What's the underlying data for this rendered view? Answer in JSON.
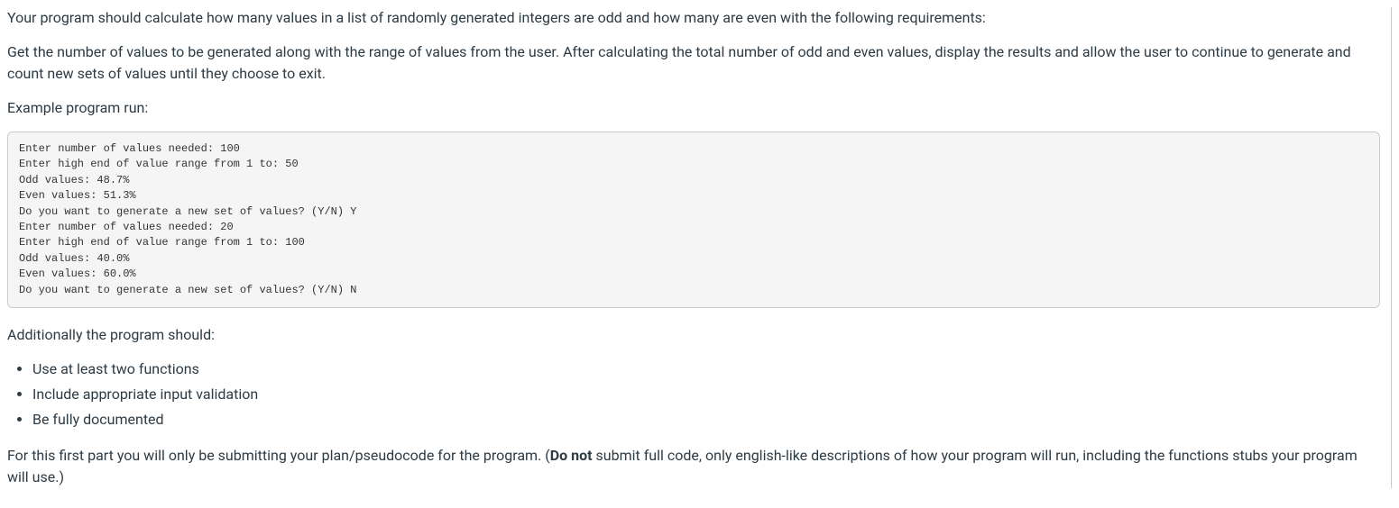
{
  "intro": "Your program should calculate how many values in a list of randomly generated integers are odd and how many are even with the following requirements:",
  "requirements": "Get the number of values to be generated along with the range of values from the user. After calculating the total number of odd and even values, display the results and allow the user to continue to generate and count new sets of values until they choose to exit.",
  "example_label": "Example program run:",
  "code_output": "Enter number of values needed: 100\nEnter high end of value range from 1 to: 50\nOdd values: 48.7%\nEven values: 51.3%\nDo you want to generate a new set of values? (Y/N) Y\nEnter number of values needed: 20\nEnter high end of value range from 1 to: 100\nOdd values: 40.0%\nEven values: 60.0%\nDo you want to generate a new set of values? (Y/N) N",
  "additional_label": "Additionally the program should:",
  "bullets": [
    "Use at least two functions",
    "Include appropriate input validation",
    "Be fully documented"
  ],
  "final_prefix": "For this first part you will only be submitting your plan/pseudocode for the program. (",
  "final_bold": "Do not",
  "final_suffix": " submit full code, only english-like descriptions of how your program will run, including the functions stubs your program will use.)"
}
